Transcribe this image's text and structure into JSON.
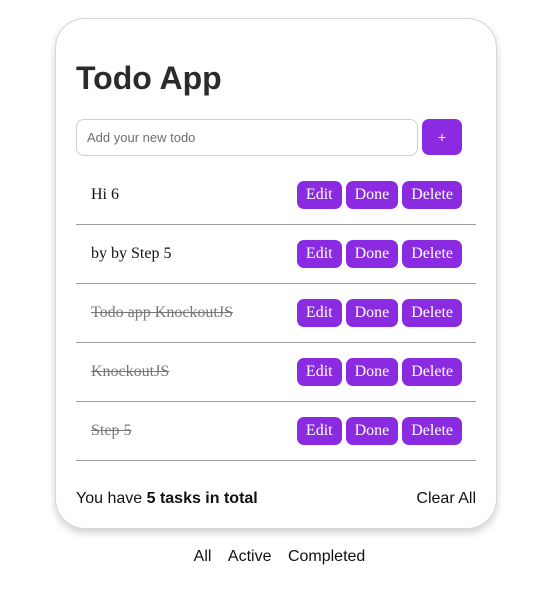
{
  "app": {
    "title": "Todo App",
    "new_todo_placeholder": "Add your new todo",
    "add_button_label": "+"
  },
  "todos": [
    {
      "text": "Hi 6",
      "completed": false,
      "edit_label": "Edit",
      "done_label": "Done",
      "delete_label": "Delete"
    },
    {
      "text": "by by Step 5",
      "completed": false,
      "edit_label": "Edit",
      "done_label": "Done",
      "delete_label": "Delete"
    },
    {
      "text": "Todo app KnockoutJS",
      "completed": true,
      "edit_label": "Edit",
      "done_label": "Done",
      "delete_label": "Delete"
    },
    {
      "text": "KnockoutJS",
      "completed": true,
      "edit_label": "Edit",
      "done_label": "Done",
      "delete_label": "Delete"
    },
    {
      "text": "Step 5",
      "completed": true,
      "edit_label": "Edit",
      "done_label": "Done",
      "delete_label": "Delete"
    }
  ],
  "footer": {
    "summary_prefix": "You have",
    "summary_count": "5 tasks in total",
    "clear_all_label": "Clear All"
  },
  "filters": {
    "all": "All",
    "active": "Active",
    "completed": "Completed"
  },
  "colors": {
    "accent": "#8a2be2",
    "text": "#111111",
    "completed_text": "#777777"
  }
}
